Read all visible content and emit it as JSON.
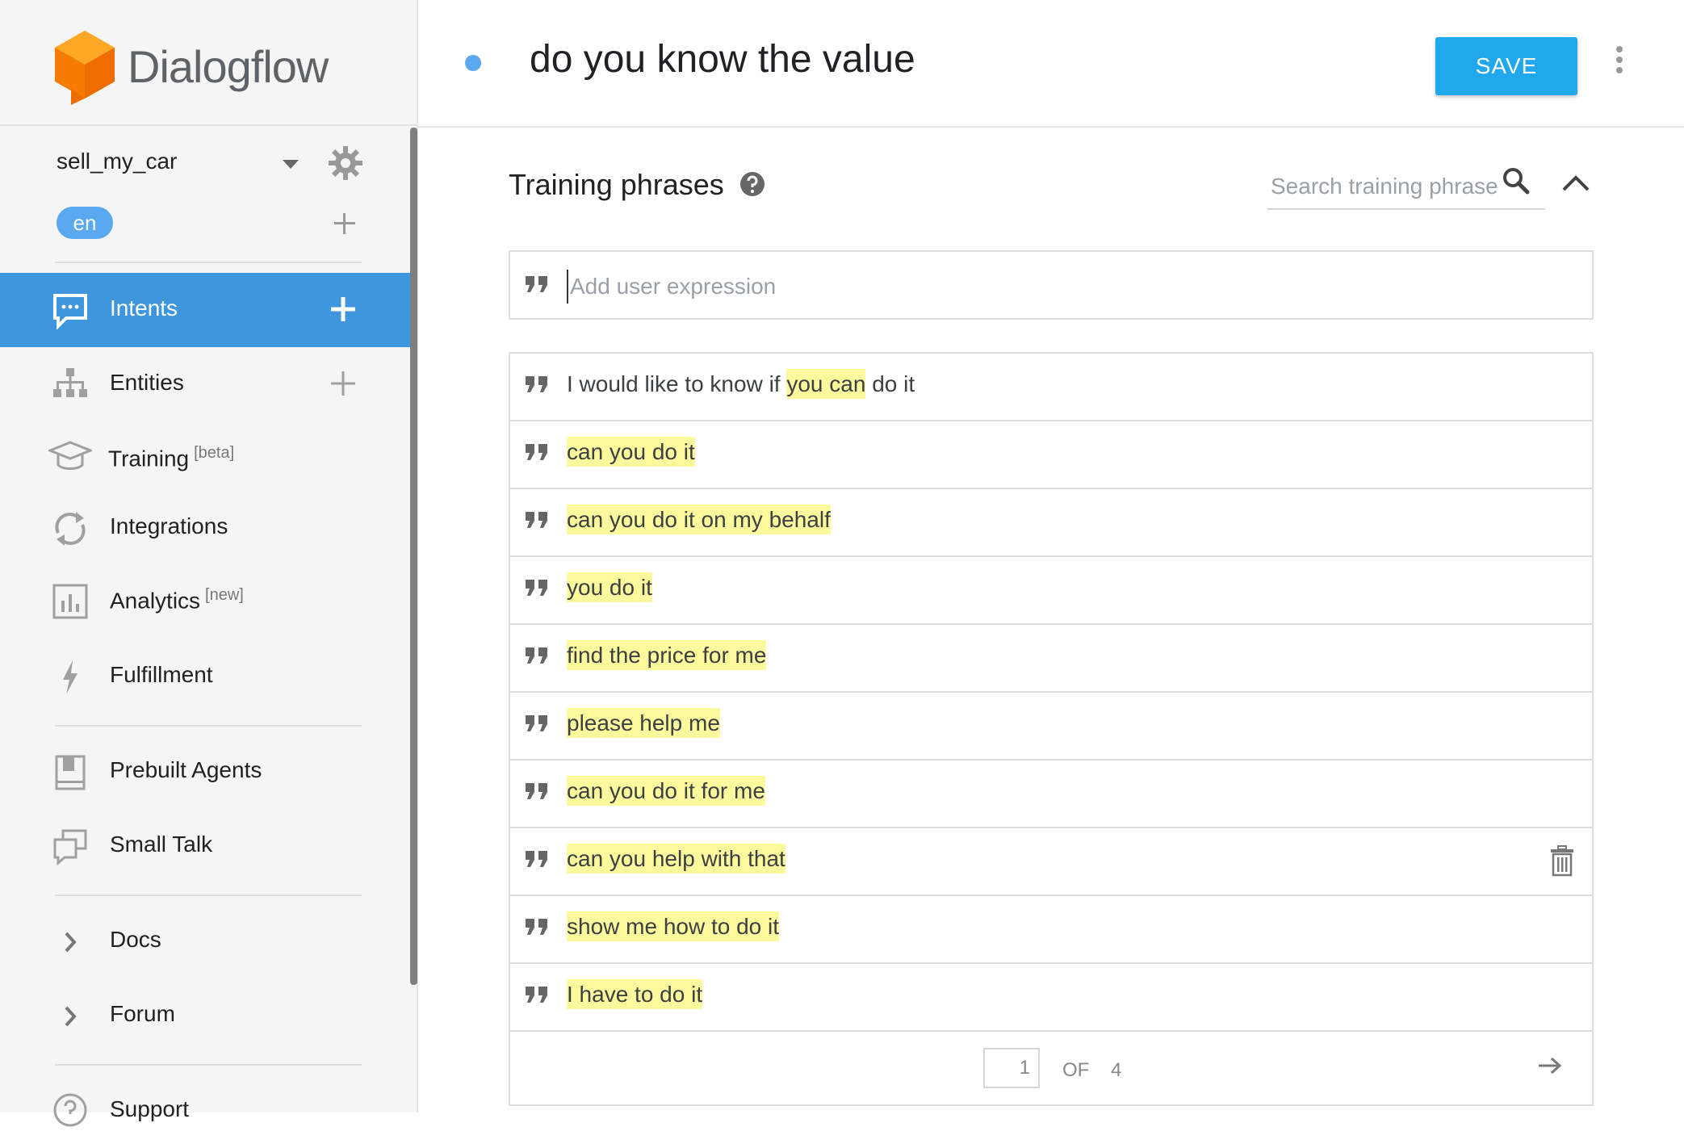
{
  "app": {
    "name": "Dialogflow"
  },
  "agent": {
    "name": "sell_my_car",
    "language": "en"
  },
  "sidebar": {
    "items": [
      {
        "label": "Intents",
        "sup": "",
        "icon": "chat-bubble-icon",
        "active": true,
        "addable": true
      },
      {
        "label": "Entities",
        "sup": "",
        "icon": "hierarchy-icon",
        "active": false,
        "addable": true
      },
      {
        "label": "Training",
        "sup": "[beta]",
        "icon": "graduation-cap-icon",
        "active": false,
        "addable": false
      },
      {
        "label": "Integrations",
        "sup": "",
        "icon": "sync-icon",
        "active": false,
        "addable": false
      },
      {
        "label": "Analytics",
        "sup": "[new]",
        "icon": "bar-chart-icon",
        "active": false,
        "addable": false
      },
      {
        "label": "Fulfillment",
        "sup": "",
        "icon": "bolt-icon",
        "active": false,
        "addable": false
      },
      {
        "label": "Prebuilt Agents",
        "sup": "",
        "icon": "book-icon",
        "active": false,
        "addable": false
      },
      {
        "label": "Small Talk",
        "sup": "",
        "icon": "chat-windows-icon",
        "active": false,
        "addable": false
      },
      {
        "label": "Docs",
        "sup": "",
        "icon": "chevron-right-icon",
        "active": false,
        "addable": false
      },
      {
        "label": "Forum",
        "sup": "",
        "icon": "chevron-right-icon",
        "active": false,
        "addable": false
      },
      {
        "label": "Support",
        "sup": "",
        "icon": "help-circle-icon",
        "active": false,
        "addable": false
      }
    ]
  },
  "header": {
    "intent_title": "do you know the value",
    "save_label": "SAVE"
  },
  "training": {
    "title": "Training phrases",
    "search_placeholder": "Search training phrase",
    "add_placeholder": "Add user expression",
    "phrases": [
      {
        "before": "I would like to know if ",
        "highlight": "you can",
        "after": " do it"
      },
      {
        "before": "",
        "highlight": "can you do it",
        "after": ""
      },
      {
        "before": "",
        "highlight": "can you do it on my behalf",
        "after": ""
      },
      {
        "before": "",
        "highlight": "you do it",
        "after": ""
      },
      {
        "before": "",
        "highlight": "find the price for me",
        "after": ""
      },
      {
        "before": "",
        "highlight": "please help me",
        "after": ""
      },
      {
        "before": "",
        "highlight": "can you do it for me",
        "after": ""
      },
      {
        "before": "",
        "highlight": "can you help with that",
        "after": ""
      },
      {
        "before": "",
        "highlight": "show me how to do it",
        "after": ""
      },
      {
        "before": "",
        "highlight": "I have to do it",
        "after": ""
      }
    ],
    "hovered_row_index": 7,
    "pagination": {
      "current": "1",
      "of_label": "OF",
      "total": "4"
    }
  },
  "colors": {
    "accent": "#3e96de",
    "save_button": "#21a7ec",
    "highlight": "#fdfa9e",
    "status_dot": "#5aa9f0"
  }
}
